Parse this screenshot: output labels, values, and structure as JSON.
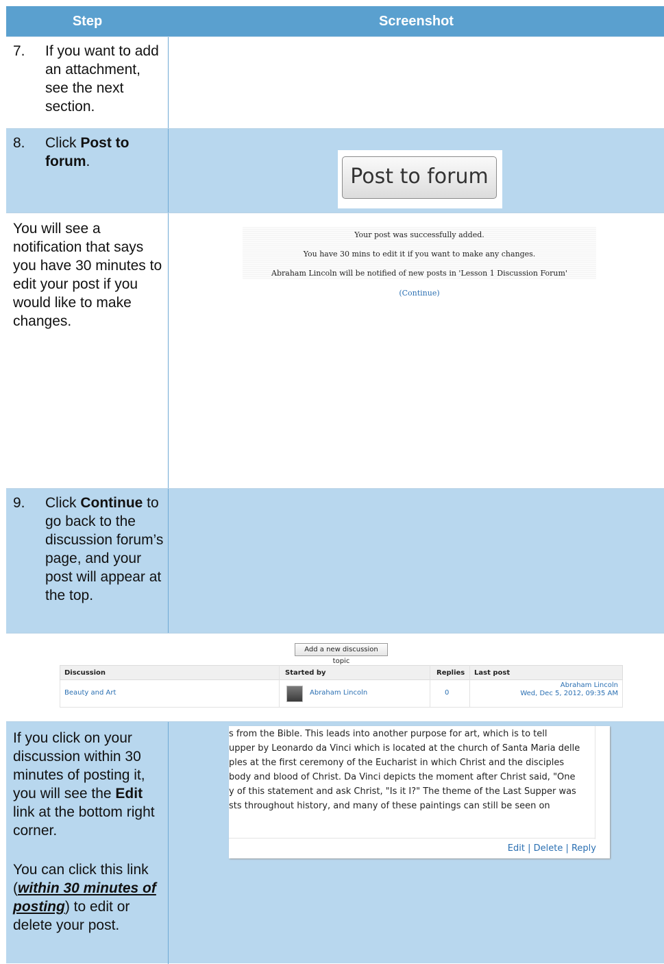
{
  "header": {
    "step_col": "Step",
    "screenshot_col": "Screenshot"
  },
  "step7": {
    "num": "7.",
    "text": "If you want to add an attachment, see the next section."
  },
  "step8": {
    "num": "8.",
    "pre": "Click ",
    "bold": "Post to forum",
    "post": ".",
    "button_label": "Post to forum"
  },
  "notification_step": {
    "text": "You will see a notification that says you have 30 minutes to edit your post if you would like to make changes."
  },
  "notification": {
    "line1": "Your post was successfully added.",
    "line2": "You have 30 mins to edit it if you want to make any changes.",
    "line3": "Abraham Lincoln will be notified of new posts in 'Lesson 1 Discussion Forum'",
    "continue_open": "(",
    "continue_link": "Continue",
    "continue_close": ")"
  },
  "step9": {
    "num": "9.",
    "pre": "Click ",
    "bold": "Continue",
    "post": " to go back to the discussion forum’s page, and your post will appear at the top."
  },
  "forum": {
    "add_button": "Add a new discussion topic",
    "columns": {
      "discussion": "Discussion",
      "started_by": "Started by",
      "replies": "Replies",
      "last_post": "Last post"
    },
    "row": {
      "discussion": "Beauty and Art",
      "started_by": "Abraham Lincoln",
      "replies": "0",
      "last_post_author": "Abraham Lincoln",
      "last_post_date": "Wed, Dec 5, 2012, 09:35 AM"
    }
  },
  "edit_step": {
    "p1_pre": "If you click on your discussion within 30 minutes of posting it, you will see the ",
    "p1_bold": "Edit",
    "p1_post": " link at the bottom right corner.",
    "p2_pre": "You can click this link (",
    "p2_emph": "within 30 minutes of posting",
    "p2_post": ") to edit or delete your post."
  },
  "excerpt": {
    "lines": [
      "s from the Bible. This leads into another purpose for art, which is to tell",
      "upper by Leonardo da Vinci which is located at the church of Santa Maria delle",
      "ples at the first ceremony of the Eucharist in which Christ and the disciples",
      " body and blood of Christ. Da Vinci depicts the moment after Christ said, \"One",
      "y of this statement and ask Christ, \"Is it I?\"   The theme of the Last Supper was",
      "sts throughout history, and many of these paintings can still be seen on"
    ],
    "edit": "Edit",
    "delete": "Delete",
    "reply": "Reply",
    "separator": " | "
  },
  "colors": {
    "header_bg": "#5aa0cf",
    "row_blue": "#b8d7ee",
    "link": "#2a6fb2"
  }
}
